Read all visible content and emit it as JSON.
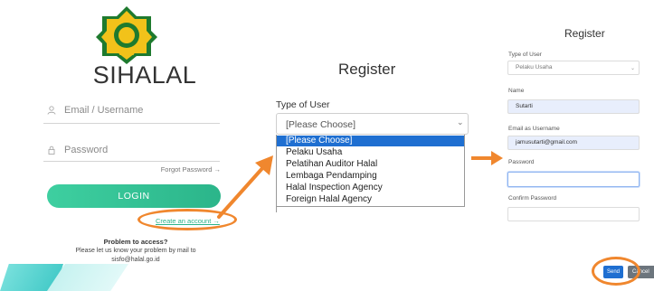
{
  "login": {
    "app_title": "SIHALAL",
    "email_placeholder": "Email / Username",
    "password_placeholder": "Password",
    "forgot_password": "Forgot Password →",
    "login_button": "LOGIN",
    "create_account": "Create an account →",
    "problem_title": "Problem to access?",
    "problem_text": "Please let us know your problem by mail to",
    "problem_email": "sisfo@halal.go.id"
  },
  "register": {
    "title": "Register",
    "type_label": "Type of User",
    "select_value": "[Please Choose]",
    "options": [
      "[Please Choose]",
      "Pelaku Usaha",
      "Pelatihan Auditor Halal",
      "Lembaga Pendamping",
      "Halal Inspection Agency",
      "Foreign Halal Agency"
    ]
  },
  "form": {
    "title": "Register",
    "type_label": "Type of User",
    "type_value": "Pelaku Usaha",
    "name_label": "Name",
    "name_value": "Sutarti",
    "email_label": "Email as Username",
    "email_value": "jamusutarti@gmail.com",
    "password_label": "Password",
    "confirm_label": "Confirm Password",
    "send_button": "Send",
    "cancel_button": "Cancel"
  },
  "colors": {
    "accent_green": "#2db489",
    "highlight_orange": "#f0872e",
    "select_blue": "#1f6fd1"
  },
  "icons": [
    "halal-logo-icon",
    "user-icon",
    "lock-icon",
    "chevron-down-icon",
    "arrow-right-icon"
  ]
}
